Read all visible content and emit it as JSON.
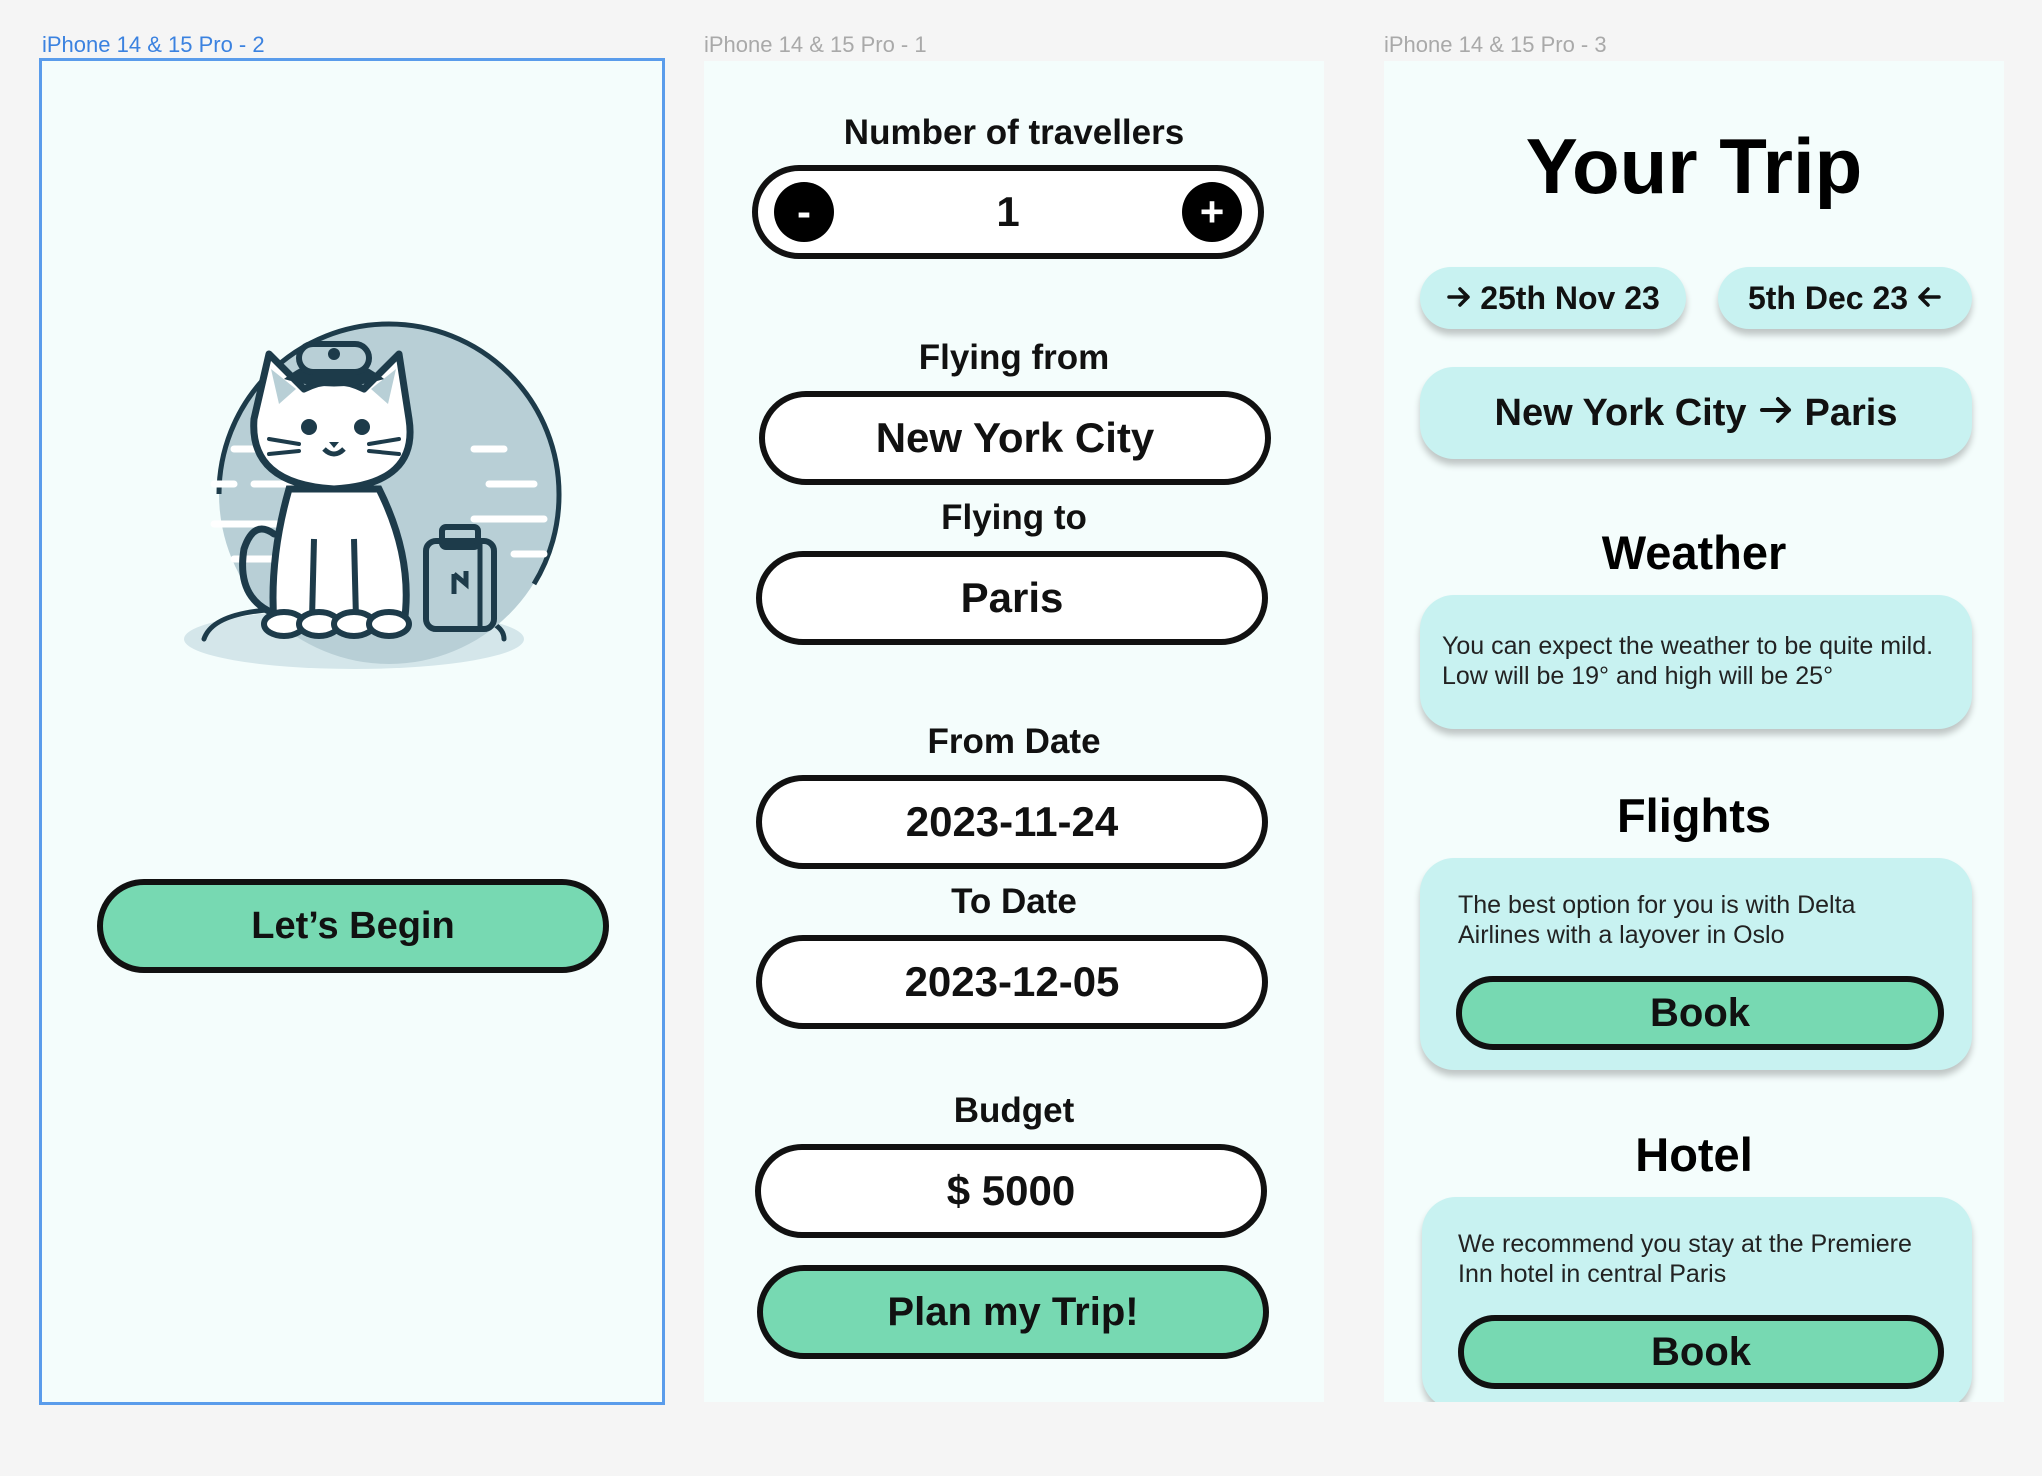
{
  "frames": {
    "welcome": {
      "label": "iPhone 14 & 15 Pro - 2",
      "begin_button": "Let’s Begin"
    },
    "form": {
      "label": "iPhone 14 & 15 Pro - 1",
      "travellers_label": "Number of travellers",
      "travellers_value": "1",
      "minus_symbol": "-",
      "plus_symbol": "+",
      "from_label": "Flying from",
      "from_value": "New York City",
      "to_label": "Flying to",
      "to_value": "Paris",
      "from_date_label": "From Date",
      "from_date_value": "2023-11-24",
      "to_date_label": "To Date",
      "to_date_value": "2023-12-05",
      "budget_label": "Budget",
      "budget_value": "$ 5000",
      "plan_button": "Plan my Trip!"
    },
    "trip": {
      "label": "iPhone 14 & 15 Pro - 3",
      "title": "Your Trip",
      "depart_date": "25th Nov 23",
      "return_date": "5th Dec 23",
      "route_from": "New York City",
      "route_to": "Paris",
      "weather_title": "Weather",
      "weather_text": "You can expect the weather to be quite mild. Low will be 19° and high will be 25°",
      "flights_title": "Flights",
      "flights_text": "The best option for you is with Delta Airlines with a layover in Oslo",
      "flights_button": "Book",
      "hotel_title": "Hotel",
      "hotel_text": "We recommend you stay at the Premiere Inn hotel in central Paris",
      "hotel_button": "Book"
    }
  },
  "colors": {
    "canvas": "#f5f5f5",
    "frame_bg": "#f4fdfc",
    "accent_green": "#77d9b2",
    "card_bg": "#c8f2f1",
    "selection_blue": "#5a9ceb"
  }
}
